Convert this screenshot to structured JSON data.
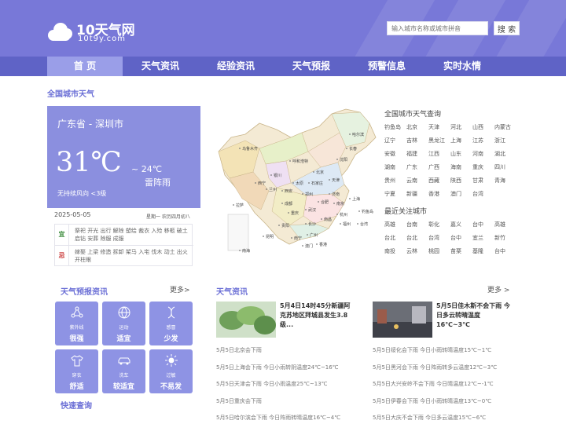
{
  "header": {
    "logo_title": "10天气网",
    "logo_sub": "10t9y.com",
    "search_placeholder": "输入城市名称或城市拼音",
    "search_button": "搜 索"
  },
  "nav": {
    "tabs": [
      "首 页",
      "天气资讯",
      "经验资讯",
      "天气预报",
      "预警信息",
      "实时水情"
    ]
  },
  "section_national": "全国城市天气",
  "weather": {
    "location": "广东省 - 深圳市",
    "temp": "31℃",
    "low": "~ 24℃",
    "condition": "雷阵雨",
    "wind": "无持续风向  <3级",
    "date": "2025-05-05",
    "weekday": "星期一  农历四月初八"
  },
  "almanac": {
    "yi_label": "宜",
    "yi_text": "祭祀 开光 出行 解除 塑绘 裁衣 入殓 移柩 破土 启钻 安葬 除服 成服",
    "ji_label": "忌",
    "ji_text": "嫁娶 上梁 修造 拆卸 架马 入宅 伐木 动土 出火 开柱眼"
  },
  "map_labels": [
    "哈尔滨",
    "长春",
    "沈阳",
    "北京",
    "天津",
    "乌鲁木齐",
    "呼和浩特",
    "银川",
    "太原",
    "石家庄",
    "济南",
    "西宁",
    "兰州",
    "西安",
    "郑州",
    "合肥",
    "南京",
    "上海",
    "拉萨",
    "成都",
    "重庆",
    "武汉",
    "杭州",
    "贵阳",
    "长沙",
    "南昌",
    "福州",
    "台湾",
    "昆明",
    "南宁",
    "广州",
    "澳门",
    "香港",
    "钓鱼岛",
    "南海"
  ],
  "city_weather": {
    "title": "全国城市天气查询",
    "cities": [
      "钓鱼岛",
      "北京",
      "天津",
      "河北",
      "山西",
      "内蒙古",
      "辽宁",
      "吉林",
      "黑龙江",
      "上海",
      "江苏",
      "浙江",
      "安徽",
      "福建",
      "江西",
      "山东",
      "河南",
      "湖北",
      "湖南",
      "广东",
      "广西",
      "海南",
      "重庆",
      "四川",
      "贵州",
      "云南",
      "西藏",
      "陕西",
      "甘肃",
      "青海",
      "宁夏",
      "新疆",
      "香港",
      "澳门",
      "台湾"
    ]
  },
  "recent_cities": {
    "title": "最近关注城市",
    "cities": [
      "高雄",
      "台南",
      "彰化",
      "嘉义",
      "台中",
      "高雄",
      "台北",
      "台北",
      "台湾",
      "台中",
      "宜兰",
      "新竹",
      "南投",
      "云林",
      "桃园",
      "苗栗",
      "基隆",
      "台中"
    ]
  },
  "forecast": {
    "title": "天气预报资讯",
    "more": "更多>",
    "tiles": [
      {
        "icon": "uv-icon",
        "small": "紫外线",
        "big": "很强"
      },
      {
        "icon": "sport-icon",
        "small": "运动",
        "big": "适宜"
      },
      {
        "icon": "allergy-icon",
        "small": "感冒",
        "big": "少发"
      },
      {
        "icon": "clothes-icon",
        "small": "穿衣",
        "big": "舒适"
      },
      {
        "icon": "car-wash-icon",
        "small": "洗车",
        "big": "较适宜"
      },
      {
        "icon": "sun-icon",
        "small": "过敏",
        "big": "不易发"
      }
    ],
    "quick": "快速查询"
  },
  "news": {
    "title": "天气资讯",
    "more": "更多 >",
    "headline1": "5月4日14时45分新疆阿克苏地区拜城县发生3.8级...",
    "headline2": "5月5日佳木斯不会下雨 今日多云转晴温度16℃~3℃",
    "left": [
      "5月5日北京会下雨",
      "5月5日上海会下雨 今日小雨转阴温度24℃~16℃",
      "5月5日天津会下雨 今日小雨温度25℃~13℃",
      "5月5日重庆会下雨",
      "5月5日哈尔滨会下雨 今日阵雨转晴温度16℃~4℃"
    ],
    "right": [
      "5月5日绥化会下雨 今日小雨转晴温度15℃~1℃",
      "5月5日黑河会下雨 今日阵雨转多云温度12℃~3℃",
      "5月5日大兴安岭不会下雨 今日晴温度12℃~-1℃",
      "5月5日伊春会下雨 今日小雨转晴温度13℃~0℃",
      "5月5日大庆不会下雨 今日多云温度15℃~6℃"
    ]
  }
}
